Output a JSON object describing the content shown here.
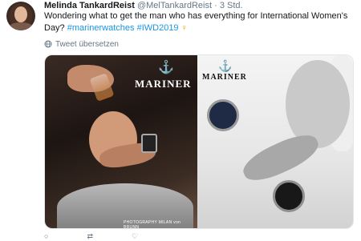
{
  "tweet": {
    "author_name": "Melinda TankardReist",
    "author_handle": "@MelTankardReist",
    "separator": "·",
    "time": "3 Std.",
    "text_main": "Wondering what to get the man who has everything for International Women's Day?",
    "hashtag1": "#marinerwatches",
    "hashtag2": "#IWD2019",
    "venus_symbol": "♀",
    "translate_label": "Tweet übersetzen"
  },
  "media": {
    "left": {
      "brand": "MARINER",
      "anchor": "⚓",
      "photo_credit": "PHOTOGRAPHY MILAN von BRUNN"
    },
    "right": {
      "brand": "MARINER",
      "anchor": "⚓"
    }
  },
  "colors": {
    "link": "#1b95e0",
    "text": "#14171a",
    "muted": "#657786"
  },
  "icons": {
    "translate": "globe-icon"
  }
}
